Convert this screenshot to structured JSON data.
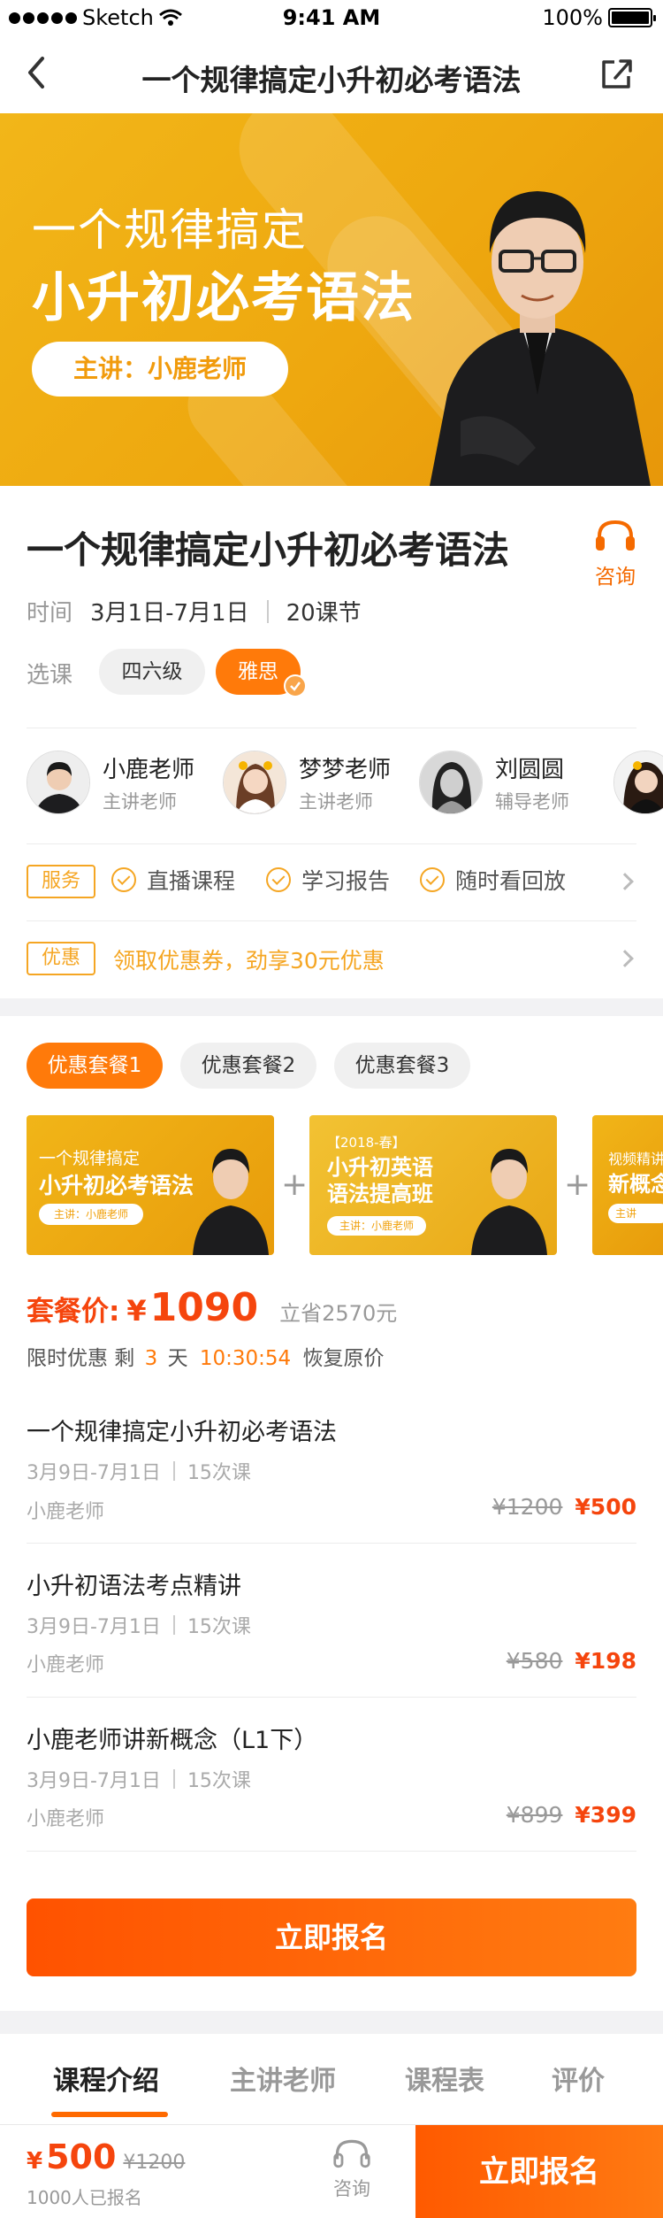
{
  "status": {
    "carrier": "Sketch",
    "time": "9:41 AM",
    "battery": "100%"
  },
  "nav": {
    "title": "一个规律搞定小升初必考语法"
  },
  "hero": {
    "line1": "一个规律搞定",
    "line2": "小升初必考语法",
    "lecturer": "主讲：小鹿老师"
  },
  "course": {
    "title": "一个规律搞定小升初必考语法",
    "consult": "咨询",
    "time_label": "时间",
    "time_value": "3月1日-7月1日",
    "lessons": "20课节",
    "select_label": "选课",
    "options": [
      "四六级",
      "雅思"
    ],
    "selected": "雅思"
  },
  "teachers": [
    {
      "name": "小鹿老师",
      "role": "主讲老师"
    },
    {
      "name": "梦梦老师",
      "role": "主讲老师"
    },
    {
      "name": "刘圆圆",
      "role": "辅导老师"
    }
  ],
  "services": {
    "tag": "服务",
    "items": [
      "直播课程",
      "学习报告",
      "随时看回放"
    ]
  },
  "promo": {
    "tag": "优惠",
    "text": "领取优惠券，劲享30元优惠"
  },
  "packages": {
    "tabs": [
      "优惠套餐1",
      "优惠套餐2",
      "优惠套餐3"
    ],
    "cards": [
      {
        "small": "一个规律搞定",
        "big": "小升初必考语法",
        "pill": "主讲：小鹿老师"
      },
      {
        "small": "【2018-春】",
        "big": "小升初英语\n语法提高班",
        "pill": "主讲：小鹿老师"
      },
      {
        "small": "视频精讲",
        "big": "新概念",
        "pill": "主讲"
      }
    ]
  },
  "package_price": {
    "label": "套餐价:",
    "currency": "¥",
    "amount": "1090",
    "save": "立省2570元",
    "limit_prefix": "限时优惠 剩",
    "days": "3",
    "days_unit": "天",
    "countdown": "10:30:54",
    "suffix": "恢复原价"
  },
  "items": [
    {
      "title": "一个规律搞定小升初必考语法",
      "date": "3月9日-7月1日",
      "count": "15次课",
      "teacher": "小鹿老师",
      "old": "¥1200",
      "new": "¥500"
    },
    {
      "title": "小升初语法考点精讲",
      "date": "3月9日-7月1日",
      "count": "15次课",
      "teacher": "小鹿老师",
      "old": "¥580",
      "new": "¥198"
    },
    {
      "title": "小鹿老师讲新概念（L1下）",
      "date": "3月9日-7月1日",
      "count": "15次课",
      "teacher": "小鹿老师",
      "old": "¥899",
      "new": "¥399"
    }
  ],
  "signup_button": "立即报名",
  "tabs": [
    "课程介绍",
    "主讲老师",
    "课程表",
    "评价"
  ],
  "active_tab": "课程介绍",
  "bottom": {
    "currency": "¥",
    "price": "500",
    "old_price": "¥1200",
    "enrolled": "1000人已报名",
    "consult": "咨询",
    "enroll": "立即报名"
  },
  "colors": {
    "accent": "#f5450d",
    "orange": "#ff6a00",
    "gold": "#f0ad14",
    "tag": "#f5a623"
  }
}
